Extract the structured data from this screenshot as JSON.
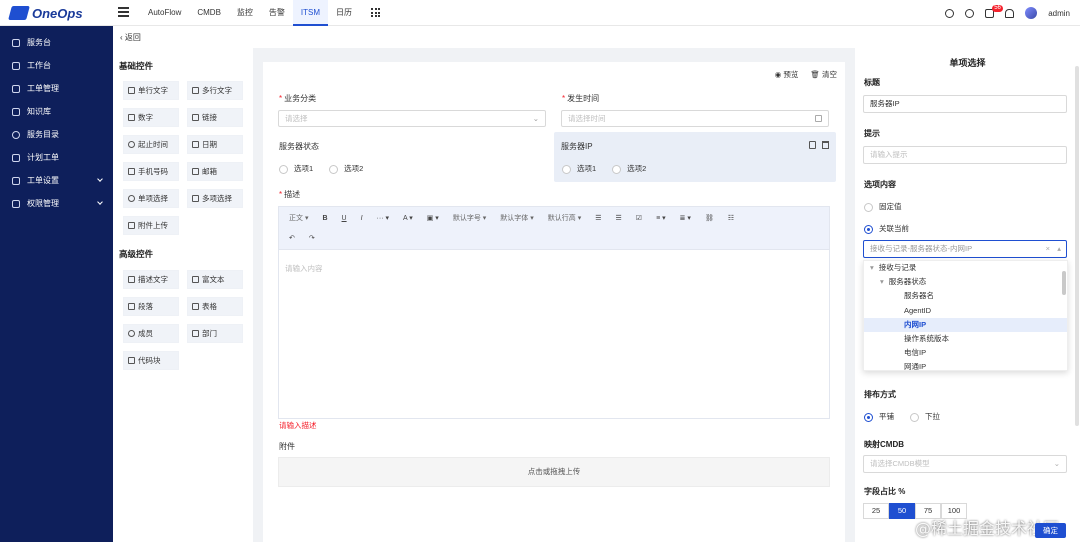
{
  "app": {
    "name": "OneOps",
    "user": "admin",
    "notifications": "56"
  },
  "topnav": [
    "AutoFlow",
    "CMDB",
    "监控",
    "告警",
    "ITSM",
    "日历"
  ],
  "sidebar": [
    "服务台",
    "工作台",
    "工单管理",
    "知识库",
    "服务目录",
    "计划工单",
    "工单设置",
    "权限管理"
  ],
  "back_label": "返回",
  "palette": {
    "basic_title": "基础控件",
    "basic": [
      "单行文字",
      "多行文字",
      "数字",
      "链接",
      "起止时间",
      "日期",
      "手机号码",
      "邮箱",
      "单项选择",
      "多项选择",
      "附件上传"
    ],
    "advanced_title": "高级控件",
    "advanced": [
      "描述文字",
      "富文本",
      "段落",
      "表格",
      "成员",
      "部门",
      "代码块"
    ]
  },
  "form": {
    "preview": "预览",
    "clear": "清空",
    "category_label": "业务分类",
    "category_placeholder": "请选择",
    "time_label": "发生时间",
    "time_placeholder": "请选择时间",
    "status_label": "服务器状态",
    "status_opt1": "选项1",
    "status_opt2": "选项2",
    "ip_label": "服务器IP",
    "ip_opt1": "选项1",
    "ip_opt2": "选项2",
    "desc_label": "描述",
    "toolbar": {
      "body": "正文",
      "font_size": "默认字号",
      "font_family": "默认字体",
      "line_height": "默认行高"
    },
    "desc_placeholder": "请输入内容",
    "desc_error": "请输入描述",
    "attach_label": "附件",
    "upload_text": "点击或拖拽上传"
  },
  "props": {
    "header": "单项选择",
    "title_label": "标题",
    "title_value": "服务器IP",
    "hint_label": "提示",
    "hint_placeholder": "请输入提示",
    "content_label": "选项内容",
    "content_fixed": "固定值",
    "content_linked": "关联当前",
    "linked_value": "接收与记录-服务器状态-内网IP",
    "tree": [
      "接收与记录",
      "服务器状态",
      "服务器名",
      "AgentID",
      "内网IP",
      "操作系统版本",
      "电信IP",
      "网通IP"
    ],
    "layout_label": "排布方式",
    "layout_flat": "平铺",
    "layout_drop": "下拉",
    "cmdb_label": "映射CMDB",
    "cmdb_placeholder": "请选择CMDB模型",
    "width_label": "字段占比 %",
    "width_options": [
      "25",
      "50",
      "75",
      "100"
    ],
    "width_selected": "50",
    "save": "确定"
  },
  "watermark": "@稀土掘金技术社区",
  "colors": {
    "primary": "#1f4fd1",
    "sidebar": "#0e1f5b",
    "error": "#f5222d"
  }
}
